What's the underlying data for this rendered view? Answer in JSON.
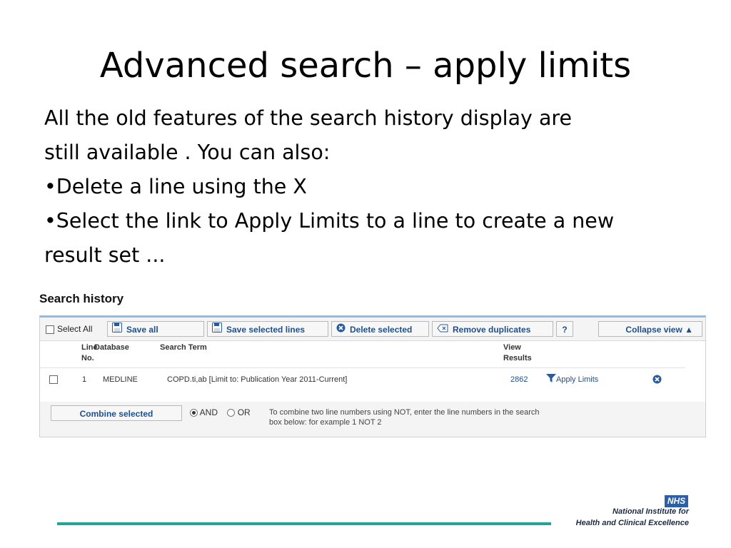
{
  "slide": {
    "title": "Advanced search – apply limits",
    "body_line1": "All the old features of the search history display are",
    "body_line2": "still available . You can also:",
    "bullet1": "•Delete a line using the X",
    "bullet2_line1": "•Select the link to Apply Limits to a line to create a new",
    "bullet2_line2": "result set ..."
  },
  "search_history": {
    "title": "Search history",
    "toolbar": {
      "select_all": "Select All",
      "save_all": "Save all",
      "save_selected": "Save selected lines",
      "delete_selected": "Delete selected",
      "remove_duplicates": "Remove duplicates",
      "help": "?",
      "collapse_view": "Collapse view ▲"
    },
    "columns": {
      "line_1": "Line",
      "line_2": "No.",
      "database": "Database",
      "search_term": "Search Term",
      "view_1": "View",
      "view_2": "Results"
    },
    "rows": [
      {
        "line": "1",
        "database": "MEDLINE",
        "search_term": "COPD.ti,ab [Limit to: Publication Year 2011-Current]",
        "results": "2862",
        "apply_limits": "Apply Limits"
      }
    ],
    "combine": {
      "button": "Combine selected",
      "and": "AND",
      "or": "OR",
      "note_line1": "To combine two line numbers using NOT, enter the line numbers in the search",
      "note_line2": "box below: for example 1 NOT 2"
    }
  },
  "footer": {
    "badge": "NHS",
    "org_line1": "National Institute for",
    "org_line2": "Health and Clinical Excellence"
  },
  "colors": {
    "link": "#1f4f8c",
    "accent_line": "#1fa69a",
    "nhs_blue": "#2d5fa8"
  }
}
